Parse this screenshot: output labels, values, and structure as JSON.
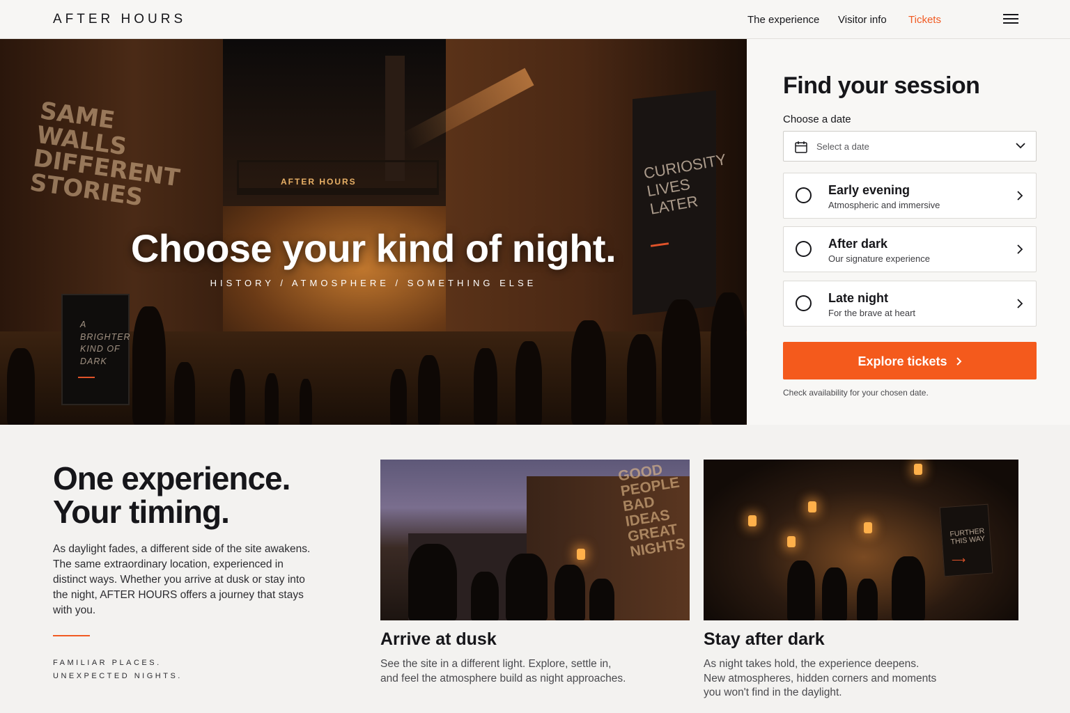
{
  "header": {
    "brand": "AFTER HOURS",
    "nav": [
      {
        "label": "The experience"
      },
      {
        "label": "Visitor info"
      },
      {
        "label": "Tickets",
        "active": true
      }
    ],
    "menu_icon": "hamburger-menu-icon"
  },
  "hero": {
    "badge": "AFTER HOURS",
    "title": "Choose your kind of night.",
    "tagline": "HISTORY / ATMOSPHERE / SOMETHING ELSE",
    "wall_text": "SAME\nWALLS\nDIFFERENT\nSTORIES",
    "banner_text": "CURIOSITY\nLIVES\nLATER",
    "sign_text": "A\nBRIGHTER\nKIND OF\nDARK"
  },
  "booking": {
    "title": "Find your session",
    "date_label": "Choose a date",
    "date_placeholder": "Select a date",
    "sessions": [
      {
        "name": "Early evening",
        "desc": "Atmospheric and immersive"
      },
      {
        "name": "After dark",
        "desc": "Our signature experience"
      },
      {
        "name": "Late night",
        "desc": "For the brave at heart"
      }
    ],
    "cta": "Explore tickets",
    "note": "Check availability for your chosen date."
  },
  "intro": {
    "title_line1": "One experience.",
    "title_line2": "Your timing.",
    "body": "As daylight fades, a different side of the site awakens. The same extraordinary location, experienced in distinct ways. Whether you arrive at dusk or stay into the night, AFTER HOURS offers a journey that stays with you.",
    "tag_line1": "FAMILIAR PLACES.",
    "tag_line2": "UNEXPECTED NIGHTS."
  },
  "cards": [
    {
      "title": "Arrive at dusk",
      "desc": "See the site in a different light. Explore, settle in, and feel the atmosphere build as night approaches.",
      "image_text": "GOOD\nPEOPLE\nBAD\nIDEAS\nGREAT\nNIGHTS"
    },
    {
      "title": "Stay after dark",
      "desc": "As night takes hold, the experience deepens. New atmospheres, hidden corners and moments you won't find in the daylight.",
      "image_text": "FURTHER\nTHIS WAY"
    }
  ],
  "colors": {
    "accent": "#f45a1c",
    "text": "#16161a",
    "background": "#f3f2f0"
  }
}
